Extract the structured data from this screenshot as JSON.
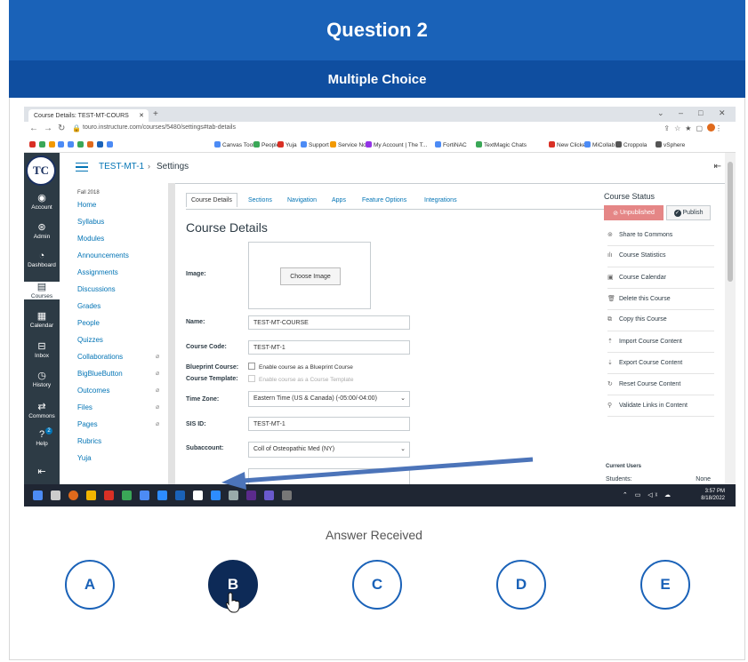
{
  "header": {
    "title": "Question 2",
    "subtitle": "Multiple Choice"
  },
  "screenshot": {
    "browser": {
      "tab_title": "Course Details: TEST-MT-COURS",
      "url": "touro.instructure.com/courses/5480/settings#tab-details",
      "bookmarks": [
        "Canvas Tools",
        "People",
        "Yuja",
        "Support",
        "Service Now",
        "My Account | The T...",
        "FortiNAC",
        "TextMagic Chats",
        "New Clicker",
        "MiCollab",
        "Croppola",
        "vSphere"
      ]
    },
    "global_nav": [
      {
        "label": "Account",
        "icon": "user-circle-icon"
      },
      {
        "label": "Admin",
        "icon": "shield-icon"
      },
      {
        "label": "Dashboard",
        "icon": "gauge-icon"
      },
      {
        "label": "Courses",
        "icon": "book-icon"
      },
      {
        "label": "Calendar",
        "icon": "calendar-icon"
      },
      {
        "label": "Inbox",
        "icon": "inbox-icon"
      },
      {
        "label": "History",
        "icon": "clock-icon"
      },
      {
        "label": "Commons",
        "icon": "commons-icon"
      },
      {
        "label": "Help",
        "icon": "help-icon",
        "badge": "2"
      }
    ],
    "breadcrumb": {
      "course": "TEST-MT-1",
      "separator": "›",
      "page": "Settings"
    },
    "course_nav": {
      "term": "Fall 2018",
      "items": [
        "Home",
        "Syllabus",
        "Modules",
        "Announcements",
        "Assignments",
        "Discussions",
        "Grades",
        "People",
        "Quizzes",
        "Collaborations",
        "BigBlueButton",
        "Outcomes",
        "Files",
        "Pages",
        "Rubrics",
        "Yuja"
      ]
    },
    "tabs": [
      "Course Details",
      "Sections",
      "Navigation",
      "Apps",
      "Feature Options",
      "Integrations"
    ],
    "page_heading": "Course Details",
    "form": {
      "image_label": "Image:",
      "choose_image": "Choose Image",
      "name_label": "Name:",
      "name_value": "TEST-MT-COURSE",
      "code_label": "Course Code:",
      "code_value": "TEST-MT-1",
      "blueprint_label": "Blueprint Course:",
      "blueprint_option": "Enable course as a Blueprint Course",
      "template_label": "Course Template:",
      "template_option": "Enable course as a Course Template",
      "timezone_label": "Time Zone:",
      "timezone_value": "Eastern Time (US & Canada) (-05:00/-04:00)",
      "sis_label": "SIS ID:",
      "sis_value": "TEST-MT-1",
      "subaccount_label": "Subaccount:",
      "subaccount_value": "Coll of Osteopathic Med (NY)"
    },
    "sidebar": {
      "status_title": "Course Status",
      "unpublished": "Unpublished",
      "publish": "Publish",
      "actions": [
        "Share to Commons",
        "Course Statistics",
        "Course Calendar",
        "Delete this Course",
        "Copy this Course",
        "Import Course Content",
        "Export Course Content",
        "Reset Course Content",
        "Validate Links in Content"
      ],
      "current_users_title": "Current Users",
      "students_label": "Students:",
      "students_value": "None"
    },
    "taskbar": {
      "time": "3:57 PM",
      "date": "8/18/2022"
    }
  },
  "answer": {
    "status": "Answer Received",
    "options": [
      "A",
      "B",
      "C",
      "D",
      "E"
    ],
    "selected": "B"
  },
  "colors": {
    "banner": "#1a62b8",
    "banner_dark": "#0f4ea0",
    "selected": "#0d2a57",
    "canvas_nav": "#2d3b45",
    "link": "#0374b5",
    "unpublished": "#e58686"
  }
}
